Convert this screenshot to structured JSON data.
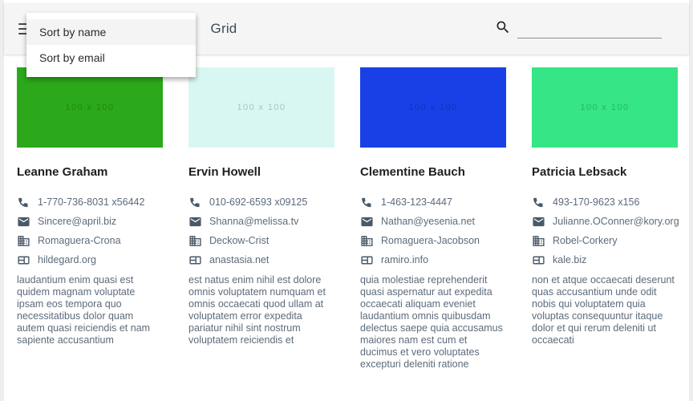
{
  "appbar": {
    "menu_icon": "hamburger-menu-icon",
    "title": "Grid",
    "search_icon": "search-icon",
    "search_value": "",
    "search_placeholder": ""
  },
  "dropdown": {
    "open": true,
    "items": [
      {
        "label": "Sort by name",
        "hovered": true
      },
      {
        "label": "Sort by email",
        "hovered": false
      }
    ]
  },
  "colors": {
    "page_background": "#eeeeee",
    "sheet_background": "#ffffff",
    "appbar_background": "#f5f5f5",
    "title_text": "#3b4a5a",
    "body_text": "#5c6b7a",
    "name_text": "#1f1f1f",
    "menu_hover": "#f4f4f4"
  },
  "thumbnail_label": "100 x 100",
  "icons": {
    "phone": "phone-icon",
    "email": "email-icon",
    "company": "business-icon",
    "website": "web-icon"
  },
  "cards": [
    {
      "name": "Leanne Graham",
      "thumb_color": "#2ca91a",
      "phone": "1-770-736-8031 x56442",
      "email": "Sincere@april.biz",
      "company": "Romaguera-Crona",
      "website": "hildegard.org",
      "blurb": "laudantium enim quasi est quidem magnam voluptate ipsam eos tempora quo necessitatibus dolor quam autem quasi reiciendis et nam sapiente accusantium"
    },
    {
      "name": "Ervin Howell",
      "thumb_color": "#d9f7f2",
      "phone": "010-692-6593 x09125",
      "email": "Shanna@melissa.tv",
      "company": "Deckow-Crist",
      "website": "anastasia.net",
      "blurb": "est natus enim nihil est dolore omnis voluptatem numquam et omnis occaecati quod ullam at voluptatem error expedita pariatur nihil sint nostrum voluptatem reiciendis et"
    },
    {
      "name": "Clementine Bauch",
      "thumb_color": "#1940e6",
      "phone": "1-463-123-4447",
      "email": "Nathan@yesenia.net",
      "company": "Romaguera-Jacobson",
      "website": "ramiro.info",
      "blurb": "quia molestiae reprehenderit quasi aspernatur aut expedita occaecati aliquam eveniet laudantium omnis quibusdam delectus saepe quia accusamus maiores nam est cum et ducimus et vero voluptates excepturi deleniti ratione"
    },
    {
      "name": "Patricia Lebsack",
      "thumb_color": "#35e586",
      "phone": "493-170-9623 x156",
      "email": "Julianne.OConner@kory.org",
      "company": "Robel-Corkery",
      "website": "kale.biz",
      "blurb": "non et atque occaecati deserunt quas accusantium unde odit nobis qui voluptatem quia voluptas consequuntur itaque dolor et qui rerum deleniti ut occaecati"
    }
  ]
}
